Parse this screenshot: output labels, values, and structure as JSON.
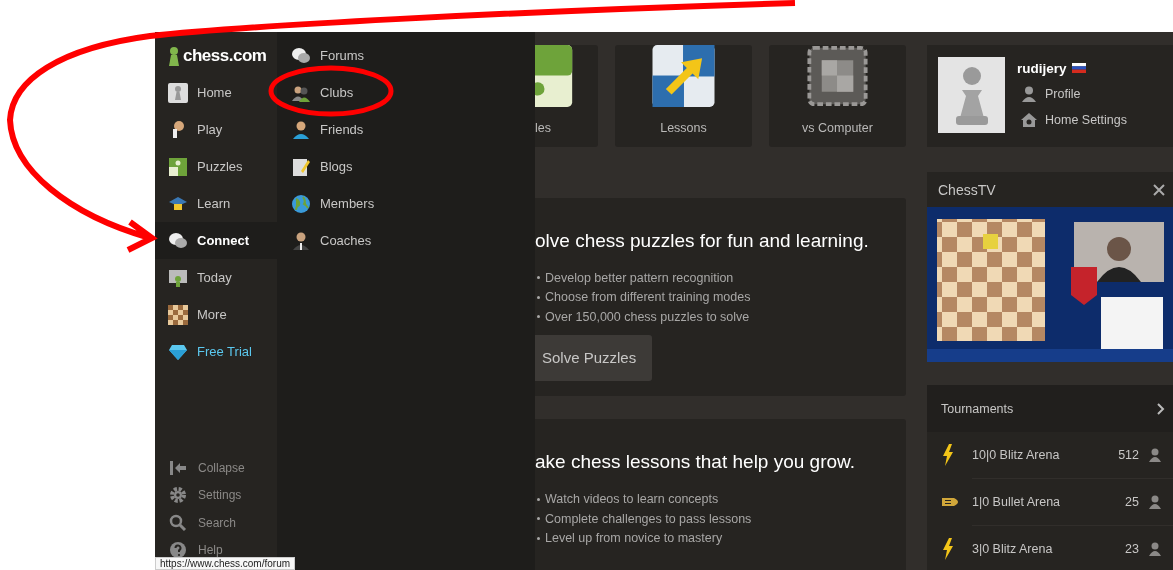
{
  "logo": {
    "text": "chess.com"
  },
  "sidebar": {
    "items": [
      {
        "label": "Home",
        "selected": false,
        "kind": "nav"
      },
      {
        "label": "Play",
        "selected": false,
        "kind": "nav"
      },
      {
        "label": "Puzzles",
        "selected": false,
        "kind": "nav"
      },
      {
        "label": "Learn",
        "selected": false,
        "kind": "nav"
      },
      {
        "label": "Connect",
        "selected": true,
        "kind": "nav"
      },
      {
        "label": "Today",
        "selected": false,
        "kind": "nav"
      },
      {
        "label": "More",
        "selected": false,
        "kind": "nav"
      },
      {
        "label": "Free Trial",
        "selected": false,
        "kind": "promo"
      }
    ],
    "footer_items": [
      {
        "label": "Collapse"
      },
      {
        "label": "Settings"
      },
      {
        "label": "Search"
      },
      {
        "label": "Help"
      }
    ]
  },
  "flyout": {
    "items": [
      {
        "label": "Forums"
      },
      {
        "label": "Clubs"
      },
      {
        "label": "Friends"
      },
      {
        "label": "Blogs"
      },
      {
        "label": "Members"
      },
      {
        "label": "Coaches"
      }
    ]
  },
  "quick_links": [
    {
      "label": "les"
    },
    {
      "label": "Lessons"
    },
    {
      "label": "vs Computer"
    }
  ],
  "promos": [
    {
      "title": "olve chess puzzles for fun and learning.",
      "bullets": [
        "Develop better pattern recognition",
        "Choose from different training modes",
        "Over 150,000 chess puzzles to solve"
      ],
      "button": "Solve Puzzles"
    },
    {
      "title": "ake chess lessons that help you grow.",
      "bullets": [
        "Watch videos to learn concepts",
        "Complete challenges to pass lessons",
        "Level up from novice to mastery"
      ]
    }
  ],
  "profile": {
    "username": "rudijery",
    "links": [
      "Profile",
      "Home Settings"
    ]
  },
  "chess_tv": {
    "title": "ChessTV"
  },
  "tournaments": {
    "title": "Tournaments",
    "rows": [
      {
        "name": "10|0 Blitz Arena",
        "players": "512",
        "kind": "blitz"
      },
      {
        "name": "1|0 Bullet Arena",
        "players": "25",
        "kind": "bullet"
      },
      {
        "name": "3|0 Blitz Arena",
        "players": "23",
        "kind": "blitz"
      }
    ]
  },
  "status_tooltip": "https://www.chess.com/forum"
}
